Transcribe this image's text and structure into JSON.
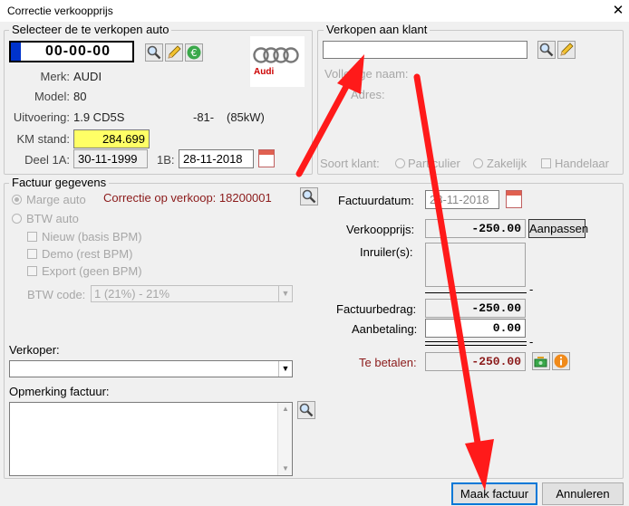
{
  "window": {
    "title": "Correctie verkoopprijs",
    "close": "✕"
  },
  "vehicle": {
    "legend": "Selecteer de te verkopen auto",
    "plate": "00-00-00",
    "merk_label": "Merk:",
    "merk": "AUDI",
    "model_label": "Model:",
    "model": "80",
    "uitvoering_label": "Uitvoering:",
    "uitvoering": "1.9 CD5S",
    "uitvoering_code": "-81-",
    "uitvoering_power": "(85kW)",
    "km_label": "KM stand:",
    "km": "284.699",
    "deel1a_label": "Deel 1A:",
    "deel1a": "30-11-1999",
    "deel1b_label": "1B:",
    "deel1b": "28-11-2018",
    "logo_text": "Audi"
  },
  "customer": {
    "legend": "Verkopen aan klant",
    "search_value": "",
    "naam_label": "Volledige naam:",
    "adres_label": "Adres:",
    "soort_label": "Soort klant:",
    "soort_options": [
      "Particulier",
      "Zakelijk",
      "Handelaar"
    ]
  },
  "invoice": {
    "legend": "Factuur gegevens",
    "marge_label": "Marge auto",
    "btw_label": "BTW auto",
    "nieuw_label": "Nieuw (basis BPM)",
    "demo_label": "Demo (rest BPM)",
    "export_label": "Export (geen BPM)",
    "btw_code_label": "BTW code:",
    "btw_code_value": "1 (21%) - 21%",
    "correctie_text": "Correctie op verkoop: 18200001",
    "factuurdatum_label": "Factuurdatum:",
    "factuurdatum": "28-11-2018",
    "verkoopprijs_label": "Verkoopprijs:",
    "verkoopprijs": "-250.00",
    "aanpassen": "Aanpassen",
    "inruiler_label": "Inruiler(s):",
    "factuurbedrag_label": "Factuurbedrag:",
    "factuurbedrag": "-250.00",
    "aanbetaling_label": "Aanbetaling:",
    "aanbetaling": "0.00",
    "te_betalen_label": "Te betalen:",
    "te_betalen": "-250.00",
    "verkoper_label": "Verkoper:",
    "verkoper_value": "",
    "opmerking_label": "Opmerking factuur:",
    "minus_sign": "-"
  },
  "footer": {
    "maak_factuur": "Maak factuur",
    "annuleren": "Annuleren"
  },
  "colors": {
    "km_highlight": "#ffff66",
    "correctie_text": "#8b1a1a",
    "te_betalen_label": "#8b1a1a",
    "te_betalen_value": "#8b1a1a",
    "arrow": "#ff1a1a",
    "plate_blue": "#0033cc"
  }
}
